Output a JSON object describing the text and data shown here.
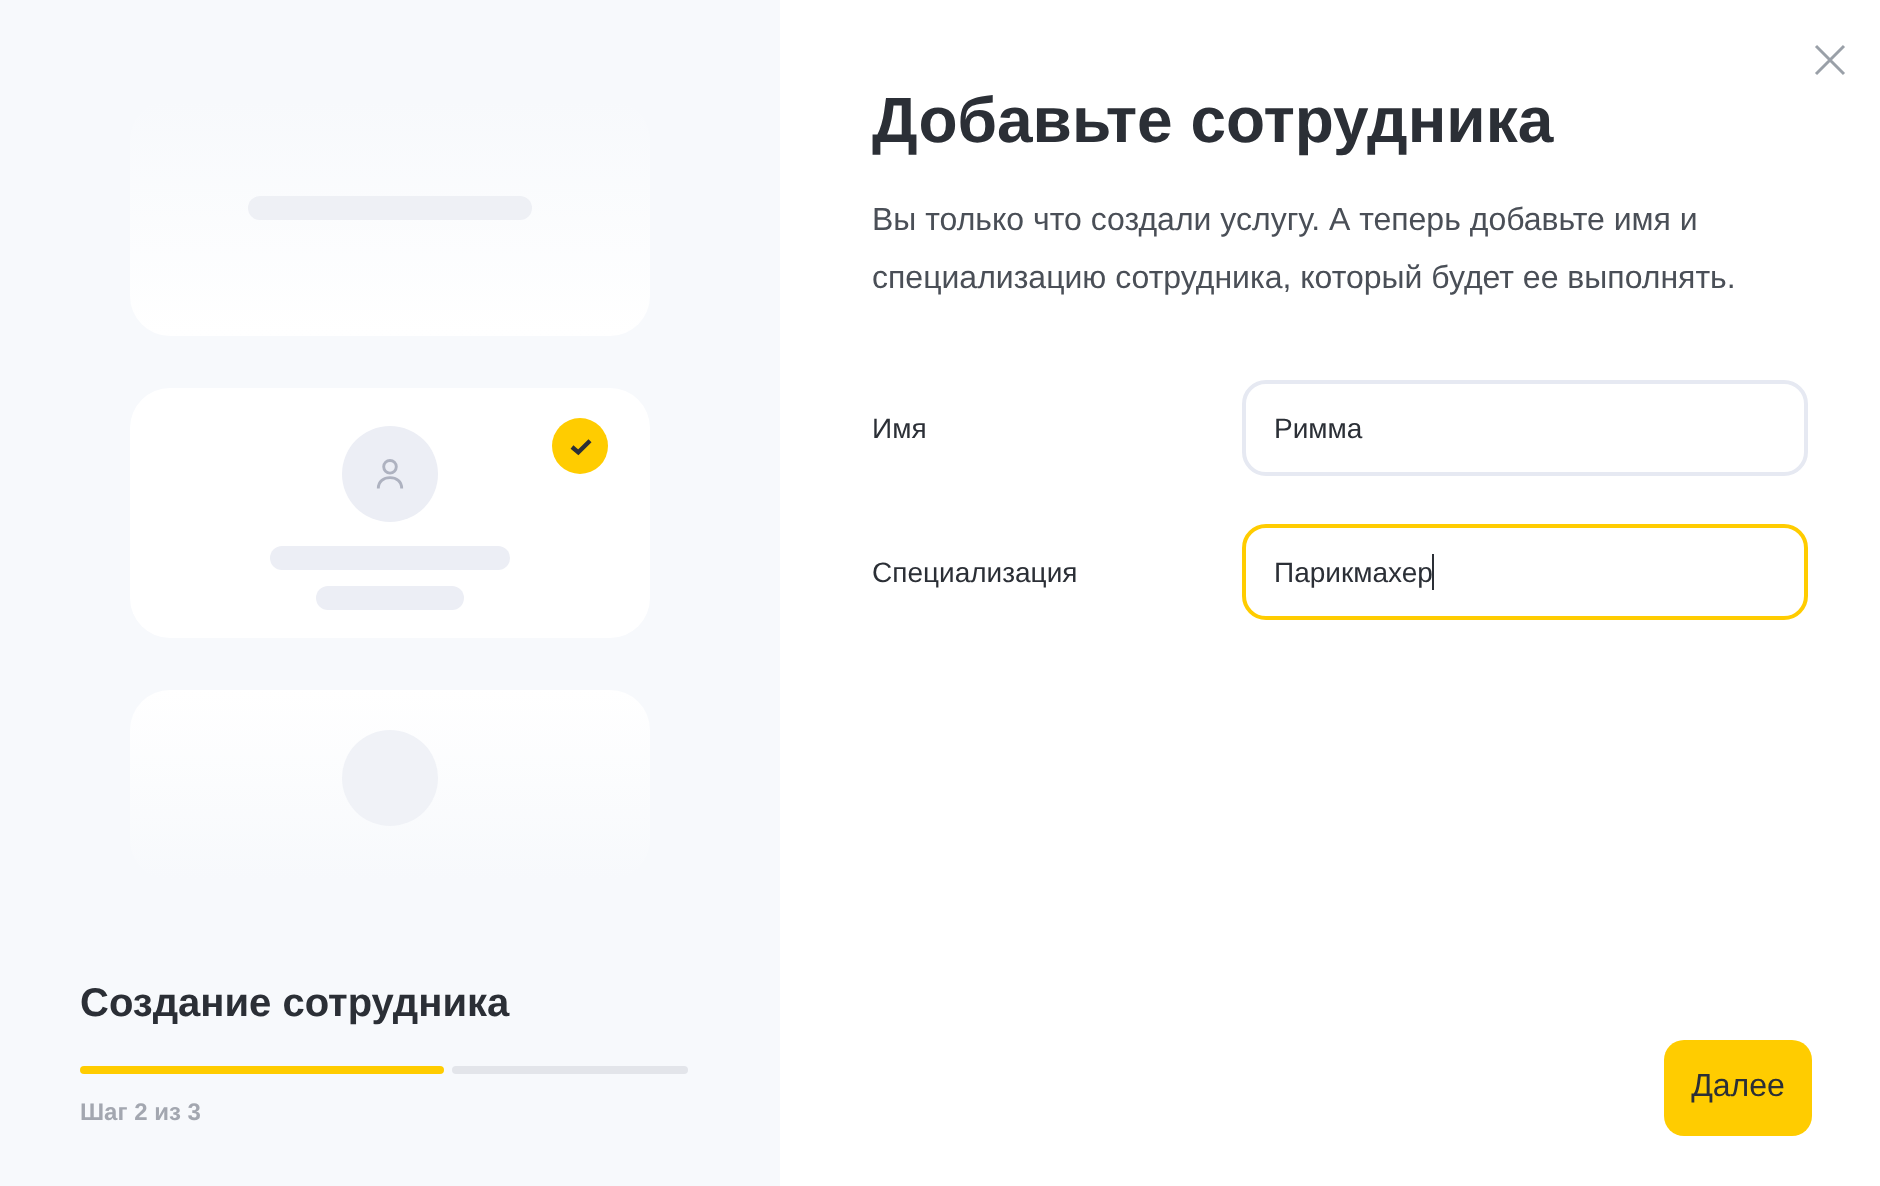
{
  "preview": {
    "cards": [
      {
        "kind": "service",
        "checked": false
      },
      {
        "kind": "employee",
        "checked": true
      },
      {
        "kind": "placeholder",
        "checked": false
      }
    ]
  },
  "progress": {
    "title": "Создание сотрудника",
    "segments": [
      {
        "done": true
      },
      {
        "done": false
      }
    ],
    "caption": "Шаг 2 из 3"
  },
  "dialog": {
    "title": "Добавьте сотрудника",
    "description": "Вы только что создали услугу. А теперь добавьте имя и специализацию сотрудника, который будет ее выполнять.",
    "fields": [
      {
        "label": "Имя",
        "value": "Римма",
        "focused": false
      },
      {
        "label": "Специализация",
        "value": "Парикмахер",
        "focused": true
      }
    ],
    "next_button": "Далее"
  }
}
